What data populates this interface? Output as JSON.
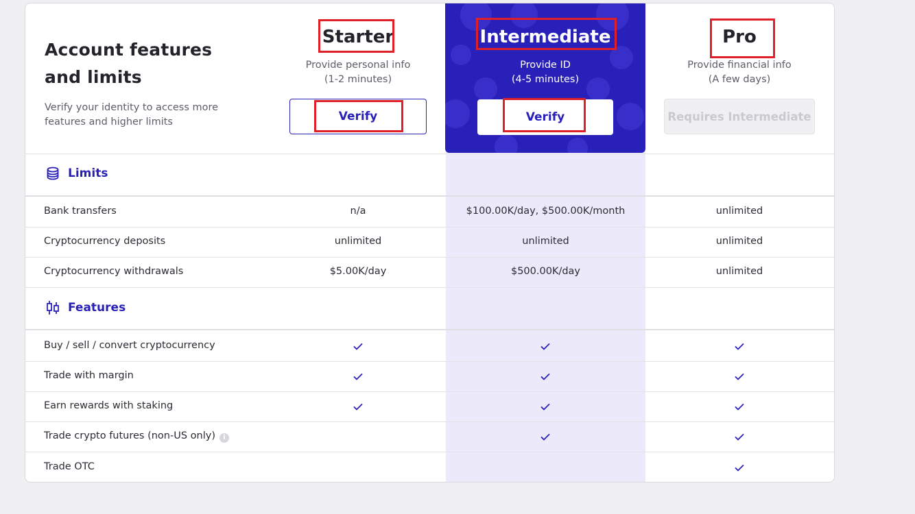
{
  "header": {
    "title": "Account features and limits",
    "subtitle": "Verify your identity to access more features and higher limits"
  },
  "tiers": [
    {
      "name": "Starter",
      "desc1": "Provide personal info",
      "desc2": "(1-2 minutes)",
      "button": "Verify"
    },
    {
      "name": "Intermediate",
      "desc1": "Provide ID",
      "desc2": "(4-5 minutes)",
      "button": "Verify"
    },
    {
      "name": "Pro",
      "desc1": "Provide financial info",
      "desc2": "(A few days)",
      "button": "Requires Intermediate"
    }
  ],
  "limits": {
    "title": "Limits",
    "rows": [
      {
        "label": "Bank transfers",
        "values": [
          "n/a",
          "$100.00K/day, $500.00K/month",
          "unlimited"
        ]
      },
      {
        "label": "Cryptocurrency deposits",
        "values": [
          "unlimited",
          "unlimited",
          "unlimited"
        ]
      },
      {
        "label": "Cryptocurrency withdrawals",
        "values": [
          "$5.00K/day",
          "$500.00K/day",
          "unlimited"
        ]
      }
    ]
  },
  "features": {
    "title": "Features",
    "rows": [
      {
        "label": "Buy / sell / convert cryptocurrency",
        "checks": [
          true,
          true,
          true
        ]
      },
      {
        "label": "Trade with margin",
        "checks": [
          true,
          true,
          true
        ]
      },
      {
        "label": "Earn rewards with staking",
        "checks": [
          true,
          true,
          true
        ]
      },
      {
        "label": "Trade crypto futures (non-US only)",
        "checks": [
          false,
          true,
          true
        ],
        "info": "i"
      },
      {
        "label": "Trade OTC",
        "checks": [
          false,
          false,
          true
        ]
      }
    ]
  },
  "colors": {
    "accent": "#2820b8",
    "highlight_band": "#ece9fa",
    "annotation": "#e01f26"
  }
}
